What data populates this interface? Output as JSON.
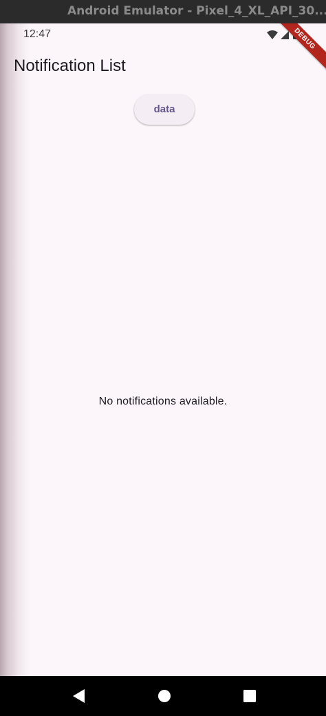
{
  "window": {
    "title": "Android Emulator - Pixel_4_XL_API_30..."
  },
  "statusbar": {
    "time": "12:47",
    "icons": [
      "wifi-icon",
      "signal-icon",
      "battery-icon"
    ],
    "debug_banner": "DEBUG"
  },
  "appbar": {
    "title": "Notification List"
  },
  "main": {
    "button_label": "data",
    "empty_message": "No notifications available."
  },
  "navbar": {
    "icons": [
      "back-icon",
      "home-icon",
      "recents-icon"
    ]
  },
  "colors": {
    "background": "#fcf6fa",
    "button_bg": "#f4edf3",
    "button_text": "#65558f",
    "debug_ribbon": "#b3261e"
  }
}
